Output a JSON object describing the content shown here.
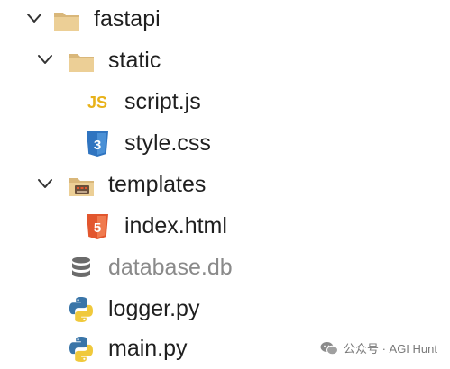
{
  "explorer": {
    "items": [
      {
        "name": "fastapi",
        "type": "folder",
        "expanded": true
      },
      {
        "name": "static",
        "type": "folder",
        "expanded": true
      },
      {
        "name": "script.js",
        "type": "file",
        "icon": "js-icon",
        "icon_text": "JS"
      },
      {
        "name": "style.css",
        "type": "file",
        "icon": "css-icon",
        "icon_text": "3"
      },
      {
        "name": "templates",
        "type": "folder",
        "expanded": true
      },
      {
        "name": "index.html",
        "type": "file",
        "icon": "html-icon",
        "icon_text": "5"
      },
      {
        "name": "database.db",
        "type": "file",
        "icon": "database-icon",
        "dimmed": true
      },
      {
        "name": "logger.py",
        "type": "file",
        "icon": "python-icon"
      },
      {
        "name": "main.py",
        "type": "file",
        "icon": "python-icon"
      }
    ]
  },
  "watermark": {
    "text": "公众号 · AGI Hunt"
  },
  "colors": {
    "folder": "#e9c98e",
    "js": "#e8b21a",
    "css": "#2f74c0",
    "html": "#e2562e",
    "python_blue": "#3a75a8",
    "python_yellow": "#f0c93c",
    "database": "#6b6b6b"
  }
}
